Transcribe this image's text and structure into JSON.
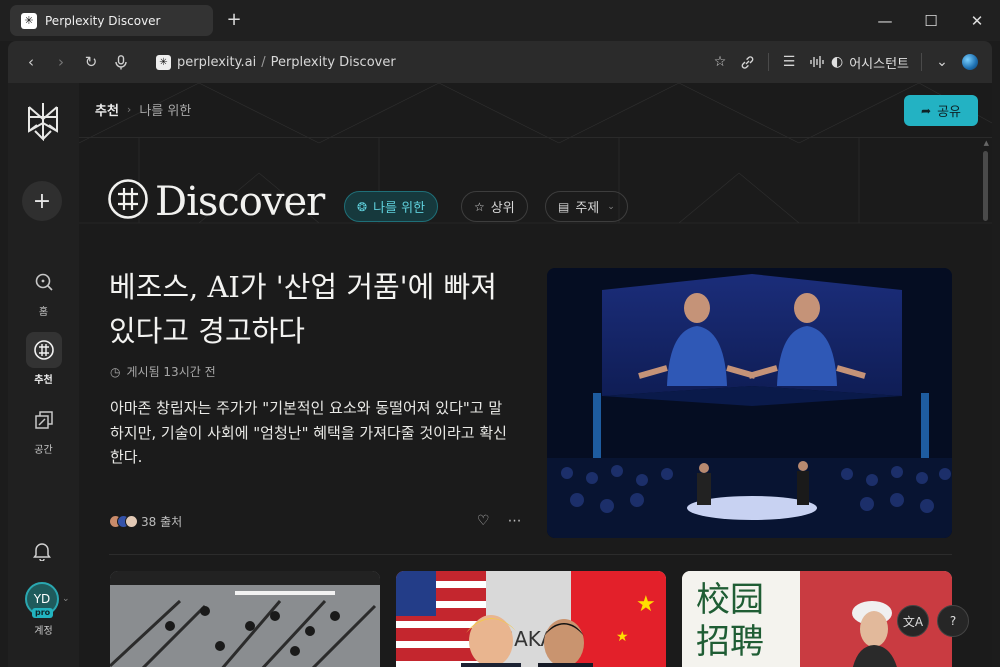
{
  "browser": {
    "tab_title": "Perplexity Discover",
    "new_tab": "+",
    "url_domain": "perplexity.ai",
    "url_sep": "/",
    "url_page": "Perplexity Discover",
    "assistant_label": "어시스턴트"
  },
  "sidebar": {
    "items": [
      {
        "label": "홈",
        "icon": "search-icon"
      },
      {
        "label": "추천",
        "icon": "discover-icon"
      },
      {
        "label": "공간",
        "icon": "spaces-icon"
      }
    ],
    "avatar_initials": "YD",
    "pro_badge": "pro",
    "account_label": "계정"
  },
  "header": {
    "crumb_root": "추천",
    "crumb_current": "나를 위한",
    "share_label": "공유"
  },
  "discover": {
    "title": "Discover",
    "pills": [
      {
        "label": "나를 위한",
        "active": true
      },
      {
        "label": "상위",
        "active": false
      },
      {
        "label": "주제",
        "active": false
      }
    ]
  },
  "article": {
    "headline": "베조스, AI가 '산업 거품'에 빠져 있다고 경고하다",
    "meta": "게시됨 13시간 전",
    "summary": "아마존 창립자는 주가가 \"기본적인 요소와 동떨어져 있다\"고 말하지만, 기술이 사회에 \"엄청난\" 혜택을 가져다줄 것이라고 확신한다.",
    "sources": "38 출처"
  },
  "thumbnails": {
    "third_sign_text": "校园\n招聘",
    "second_backdrop_text": "SAKA"
  },
  "colors": {
    "accent": "#23b2c3",
    "background": "#1b1b1b",
    "sidebar": "#202020"
  }
}
